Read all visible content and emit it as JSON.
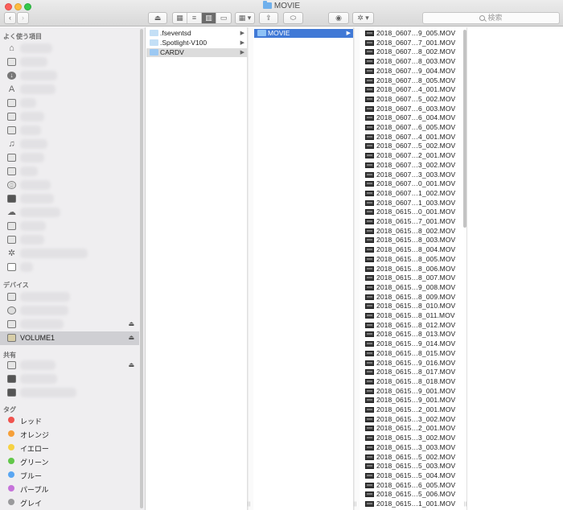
{
  "window": {
    "title": "MOVIE"
  },
  "toolbar": {
    "back_label": "‹",
    "forward_label": "›",
    "eject_label": "⏏",
    "view_icons": [
      "▦",
      "≡",
      "▥",
      "▭"
    ],
    "group_label": "▦ ▾",
    "share_label": "⇪",
    "tag_label": "⬭",
    "quicklook_label": "◉",
    "action_label": "✲ ▾",
    "search_placeholder": "検索"
  },
  "sidebar": {
    "sections": {
      "favorites": "よく使う項目",
      "devices": "デバイス",
      "shared": "共有",
      "tags": "タグ"
    },
    "favorites_icons": [
      "home-icon",
      "desktop-icon",
      "download-icon",
      "applications-icon",
      "documents-icon",
      "camera-icon",
      "movies-icon",
      "music-icon",
      "folder-icon",
      "folder-icon",
      "airdrop-icon",
      "drive-icon",
      "cloud-icon",
      "folder-icon",
      "folder-icon",
      "gear-icon",
      "document-icon"
    ],
    "devices": {
      "volume_label": "VOLUME1"
    },
    "tags": [
      {
        "label": "レッド",
        "color": "#f0534e"
      },
      {
        "label": "オレンジ",
        "color": "#f6a03a"
      },
      {
        "label": "イエロー",
        "color": "#f6d243"
      },
      {
        "label": "グリーン",
        "color": "#62c74a"
      },
      {
        "label": "ブルー",
        "color": "#5aa6f2"
      },
      {
        "label": "パープル",
        "color": "#c673da"
      },
      {
        "label": "グレイ",
        "color": "#9a9a9c"
      }
    ]
  },
  "column1": {
    "items": [
      {
        "label": ".fseventsd",
        "hidden": true
      },
      {
        "label": ".Spotlight-V100",
        "hidden": true
      },
      {
        "label": "CARDV",
        "hidden": false
      }
    ],
    "selected_index": 2
  },
  "column2": {
    "items": [
      {
        "label": "MOVIE"
      }
    ],
    "selected_index": 0
  },
  "column3": {
    "files": [
      "2018_0607…9_005.MOV",
      "2018_0607…7_001.MOV",
      "2018_0607…8_002.MOV",
      "2018_0607…8_003.MOV",
      "2018_0607…9_004.MOV",
      "2018_0607…8_005.MOV",
      "2018_0607…4_001.MOV",
      "2018_0607…5_002.MOV",
      "2018_0607…6_003.MOV",
      "2018_0607…6_004.MOV",
      "2018_0607…6_005.MOV",
      "2018_0607…4_001.MOV",
      "2018_0607…5_002.MOV",
      "2018_0607…2_001.MOV",
      "2018_0607…3_002.MOV",
      "2018_0607…3_003.MOV",
      "2018_0607…0_001.MOV",
      "2018_0607…1_002.MOV",
      "2018_0607…1_003.MOV",
      "2018_0615…0_001.MOV",
      "2018_0615…7_001.MOV",
      "2018_0615…8_002.MOV",
      "2018_0615…8_003.MOV",
      "2018_0615…8_004.MOV",
      "2018_0615…8_005.MOV",
      "2018_0615…8_006.MOV",
      "2018_0615…8_007.MOV",
      "2018_0615…9_008.MOV",
      "2018_0615…8_009.MOV",
      "2018_0615…8_010.MOV",
      "2018_0615…8_011.MOV",
      "2018_0615…8_012.MOV",
      "2018_0615…8_013.MOV",
      "2018_0615…9_014.MOV",
      "2018_0615…8_015.MOV",
      "2018_0615…9_016.MOV",
      "2018_0615…8_017.MOV",
      "2018_0615…8_018.MOV",
      "2018_0615…9_001.MOV",
      "2018_0615…9_001.MOV",
      "2018_0615…2_001.MOV",
      "2018_0615…3_002.MOV",
      "2018_0615…2_001.MOV",
      "2018_0615…3_002.MOV",
      "2018_0615…3_003.MOV",
      "2018_0615…5_002.MOV",
      "2018_0615…5_003.MOV",
      "2018_0615…5_004.MOV",
      "2018_0615…6_005.MOV",
      "2018_0615…5_006.MOV",
      "2018_0615…1_001.MOV"
    ]
  }
}
